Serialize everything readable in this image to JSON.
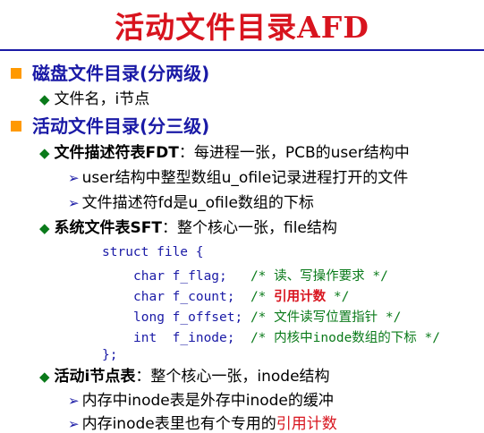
{
  "title": "活动文件目录AFD",
  "sections": [
    {
      "heading": "磁盘文件目录(分两级)",
      "items": [
        {
          "text": "文件名，i节点"
        }
      ]
    },
    {
      "heading": "活动文件目录(分三级)",
      "fdt": {
        "term": "文件描述符表FDT",
        "rest": "：每进程一张，PCB的user结构中",
        "subs": [
          "user结构中整型数组u_ofile记录进程打开的文件",
          "文件描述符fd是u_ofile数组的下标"
        ]
      },
      "sft": {
        "term": "系统文件表SFT",
        "rest": "：整个核心一张，file结构"
      },
      "code": {
        "open": "struct file {",
        "fields": [
          {
            "decl": "char f_flag;   ",
            "c_open": "/* ",
            "c_text": "读、写操作要求",
            "c_close": " */",
            "highlight": false
          },
          {
            "decl": "char f_count;  ",
            "c_open": "/* ",
            "c_text": "引用计数",
            "c_close": " */",
            "highlight": true
          },
          {
            "decl": "long f_offset; ",
            "c_open": "/* ",
            "c_text": "文件读写位置指针",
            "c_close": " */",
            "highlight": false
          },
          {
            "decl": "int  f_inode;  ",
            "c_open": "/* ",
            "c_text": "内核中inode数组的下标",
            "c_close": " */",
            "highlight": false
          }
        ],
        "close": "};"
      },
      "inode": {
        "term": "活动i节点表",
        "rest": "：整个核心一张，inode结构",
        "sub1": "内存中inode表是外存中inode的缓冲",
        "sub2_pre": "内存inode表里也有个专用的",
        "sub2_red": "引用计数"
      }
    }
  ]
}
